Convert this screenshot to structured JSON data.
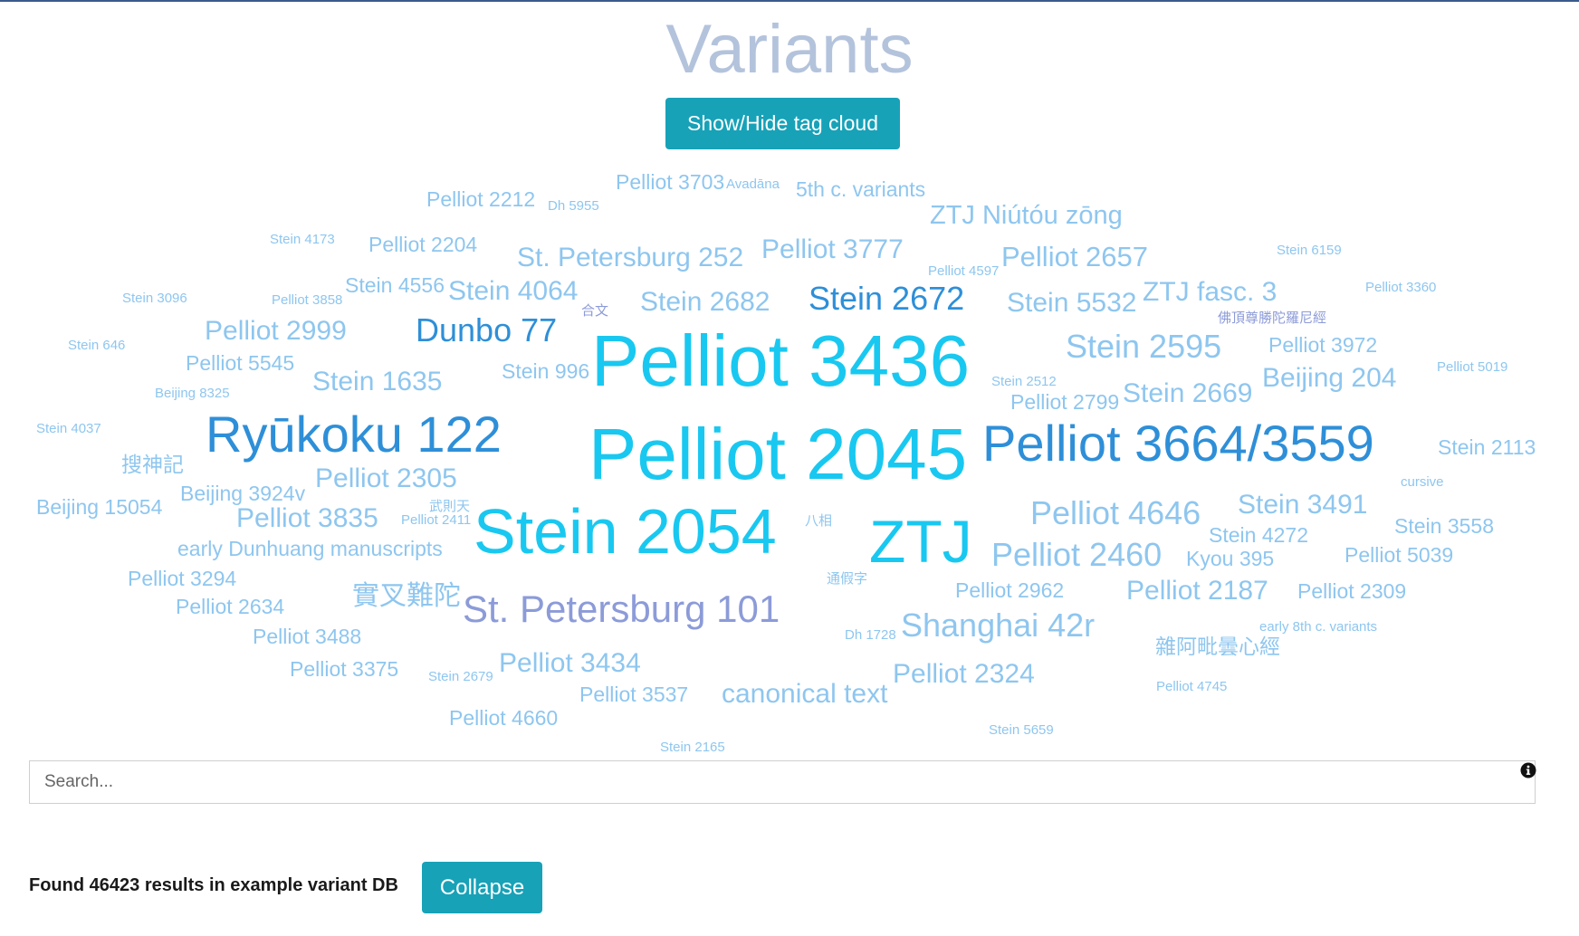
{
  "page": {
    "title": "Variants"
  },
  "toolbar": {
    "toggle_label": "Show/Hide tag cloud"
  },
  "colors": {
    "accent": "#17a2b8",
    "title": "#b4c3dc",
    "tag_large": "#19c8f0",
    "tag_medium": "#2e8fd8",
    "tag_light": "#8ec6ef",
    "tag_purple": "#8c9bd8"
  },
  "tag_cloud": [
    "Pelliot 3703",
    "Avadāna",
    "5th c. variants",
    "Pelliot 2212",
    "Dh 5955",
    "ZTJ Niútóu zōng",
    "Stein 4173",
    "Pelliot 2204",
    "St. Petersburg 252",
    "Pelliot 3777",
    "Pelliot 4597",
    "Pelliot 2657",
    "Stein 6159",
    "Stein 3096",
    "Pelliot 3858",
    "Stein 4556",
    "Stein 4064",
    "合文",
    "Stein 2682",
    "Stein 2672",
    "Stein 5532",
    "ZTJ fasc. 3",
    "Pelliot 3360",
    "佛頂尊勝陀羅尼經",
    "Stein 646",
    "Pelliot 2999",
    "Dunbo 77",
    "Pelliot 3436",
    "Stein 2595",
    "Pelliot 3972",
    "Pelliot 5545",
    "Stein 996",
    "Pelliot 5019",
    "Beijing 8325",
    "Stein 1635",
    "Stein 2512",
    "Pelliot 2799",
    "Stein 2669",
    "Beijing 204",
    "Stein 4037",
    "Ryūkoku 122",
    "Pelliot 2045",
    "Pelliot 3664/3559",
    "Stein 2113",
    "搜神記",
    "Pelliot 2305",
    "cursive",
    "Beijing 15054",
    "Beijing 3924v",
    "武則天",
    "Pelliot 2411",
    "Pelliot 3835",
    "Stein 2054",
    "八相",
    "ZTJ",
    "Pelliot 4646",
    "Stein 3491",
    "Stein 4272",
    "Stein 3558",
    "early Dunhuang manuscripts",
    "Pelliot 2460",
    "Kyou 395",
    "Pelliot 5039",
    "Pelliot 3294",
    "通假字",
    "Pelliot 2962",
    "Pelliot 2187",
    "Pelliot 2309",
    "實叉難陀",
    "Pelliot 2634",
    "St. Petersburg 101",
    "Pelliot 3488",
    "Dh 1728",
    "Shanghai 42r",
    "early 8th c. variants",
    "雜阿毗曇心經",
    "Pelliot 3375",
    "Stein 2679",
    "Pelliot 3434",
    "Pelliot 2324",
    "Pelliot 3537",
    "canonical text",
    "Pelliot 4745",
    "Pelliot 4660",
    "Stein 5659",
    "Stein 2165"
  ],
  "search": {
    "placeholder": "Search..."
  },
  "results": {
    "text": "Found 46423 results in example variant DB",
    "collapse_label": "Collapse"
  }
}
